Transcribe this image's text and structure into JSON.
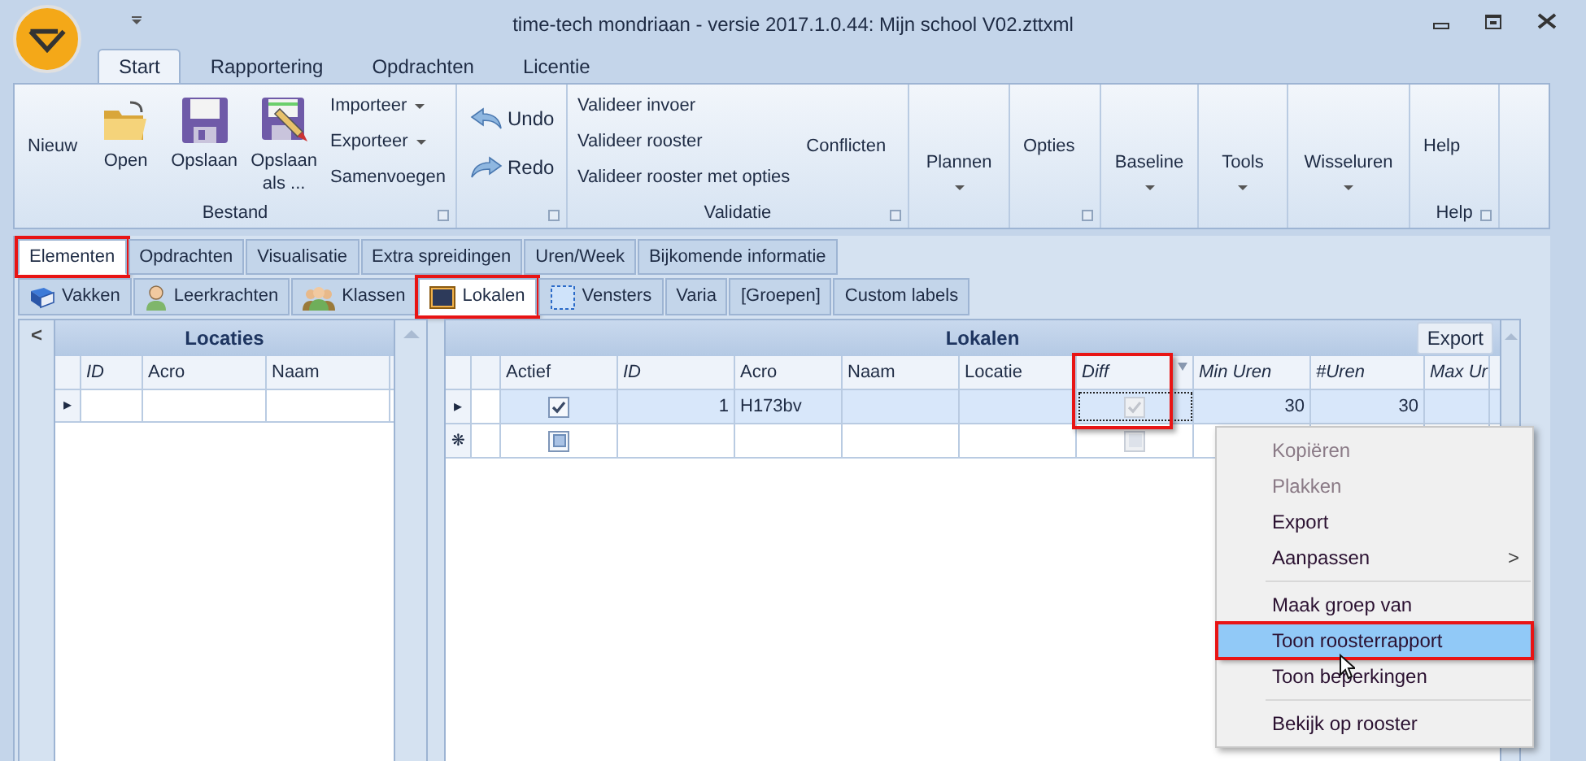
{
  "window": {
    "title": "time-tech mondriaan - versie 2017.1.0.44: Mijn school V02.zttxml"
  },
  "ribbon_tabs": [
    {
      "label": "Start",
      "selected": true
    },
    {
      "label": "Rapportering",
      "selected": false
    },
    {
      "label": "Opdrachten",
      "selected": false
    },
    {
      "label": "Licentie",
      "selected": false
    }
  ],
  "ribbon_groups": [
    {
      "label": "Bestand",
      "launcher": true,
      "items": [
        {
          "kind": "text",
          "label": "Nieuw"
        },
        {
          "kind": "large",
          "label": "Open"
        },
        {
          "kind": "large",
          "label": "Opslaan"
        },
        {
          "kind": "large",
          "label": "Opslaan als ..."
        },
        {
          "kind": "stack",
          "entries": [
            {
              "label": "Importeer",
              "dropdown": true
            },
            {
              "label": "Exporteer",
              "dropdown": true
            },
            {
              "label": "Samenvoegen",
              "dropdown": false
            }
          ]
        }
      ]
    },
    {
      "launcher": true,
      "items": [
        {
          "kind": "arrows",
          "entries": [
            {
              "label": "Undo"
            },
            {
              "label": "Redo"
            }
          ]
        }
      ]
    },
    {
      "label": "Validatie",
      "launcher": true,
      "items": [
        {
          "kind": "stack",
          "entries": [
            {
              "label": "Valideer invoer",
              "dropdown": false
            },
            {
              "label": "Valideer rooster",
              "dropdown": false
            },
            {
              "label": "Valideer rooster met opties",
              "dropdown": false
            }
          ]
        },
        {
          "kind": "text",
          "label": "Conflicten"
        }
      ]
    },
    {
      "launcher": false,
      "items": [
        {
          "kind": "menu",
          "label": "Plannen"
        }
      ]
    },
    {
      "launcher": true,
      "items": [
        {
          "kind": "text",
          "label": "Opties"
        }
      ]
    },
    {
      "launcher": false,
      "items": [
        {
          "kind": "menu",
          "label": "Baseline"
        }
      ]
    },
    {
      "launcher": false,
      "items": [
        {
          "kind": "menu",
          "label": "Tools"
        }
      ]
    },
    {
      "launcher": false,
      "items": [
        {
          "kind": "menu",
          "label": "Wisseluren"
        }
      ]
    },
    {
      "label": "Help",
      "launcher": true,
      "items": [
        {
          "kind": "text",
          "label": "Help"
        }
      ]
    }
  ],
  "main_tabs": [
    {
      "label": "Elementen",
      "selected": true,
      "highlighted": true
    },
    {
      "label": "Opdrachten",
      "selected": false,
      "highlighted": false
    },
    {
      "label": "Visualisatie",
      "selected": false,
      "highlighted": false
    },
    {
      "label": "Extra spreidingen",
      "selected": false,
      "highlighted": false
    },
    {
      "label": "Uren/Week",
      "selected": false,
      "highlighted": false
    },
    {
      "label": "Bijkomende informatie",
      "selected": false,
      "highlighted": false
    }
  ],
  "sub_tabs": [
    {
      "label": "Vakken",
      "selected": false,
      "highlighted": false
    },
    {
      "label": "Leerkrachten",
      "selected": false,
      "highlighted": false
    },
    {
      "label": "Klassen",
      "selected": false,
      "highlighted": false
    },
    {
      "label": "Lokalen",
      "selected": true,
      "highlighted": true
    },
    {
      "label": "Vensters",
      "selected": false,
      "highlighted": false
    },
    {
      "label": "Varia",
      "selected": false,
      "highlighted": false
    },
    {
      "label": "[Groepen]",
      "selected": false,
      "highlighted": false
    },
    {
      "label": "Custom labels",
      "selected": false,
      "highlighted": false
    }
  ],
  "locaties": {
    "collapse": "<",
    "title": "Locaties",
    "columns": [
      {
        "label": "ID",
        "italic": true
      },
      {
        "label": "Acro",
        "italic": false
      },
      {
        "label": "Naam",
        "italic": false
      }
    ],
    "rows": [
      {
        "indicator": "▸"
      }
    ]
  },
  "lokalen": {
    "title": "Lokalen",
    "export_button": "Export",
    "columns": [
      {
        "label": "Actief",
        "italic": false,
        "highlighted": false
      },
      {
        "label": "ID",
        "italic": true,
        "highlighted": false
      },
      {
        "label": "Acro",
        "italic": false,
        "highlighted": false
      },
      {
        "label": "Naam",
        "italic": false,
        "highlighted": false
      },
      {
        "label": "Locatie",
        "italic": false,
        "highlighted": false
      },
      {
        "label": "Diff",
        "italic": true,
        "highlighted": true
      },
      {
        "label": "Min Uren",
        "italic": true,
        "highlighted": false
      },
      {
        "label": "#Uren",
        "italic": true,
        "highlighted": false
      },
      {
        "label": "Max Ur",
        "italic": true,
        "highlighted": false
      }
    ],
    "rows": [
      {
        "indicator": "▸",
        "selected": true,
        "actief": true,
        "id": "1",
        "acro": "H173bv",
        "diff": true,
        "min_uren": "30",
        "uren": "30"
      },
      {
        "indicator": "❋",
        "selected": false,
        "actief": false,
        "diff": false
      }
    ]
  },
  "context_menu": [
    {
      "kind": "item",
      "label": "Kopiëren",
      "disabled": true,
      "selected": false
    },
    {
      "kind": "item",
      "label": "Plakken",
      "disabled": true,
      "selected": false
    },
    {
      "kind": "item",
      "label": "Export",
      "disabled": false,
      "selected": false
    },
    {
      "kind": "submenu",
      "label": "Aanpassen",
      "arrow": ">",
      "disabled": false,
      "selected": false
    },
    {
      "kind": "separator"
    },
    {
      "kind": "item",
      "label": "Maak groep van",
      "disabled": false,
      "selected": false
    },
    {
      "kind": "item",
      "label": "Toon roosterrapport",
      "disabled": false,
      "selected": true,
      "highlighted": true
    },
    {
      "kind": "item",
      "label": "Toon beperkingen",
      "disabled": false,
      "selected": false
    },
    {
      "kind": "separator"
    },
    {
      "kind": "item",
      "label": "Bekijk op rooster",
      "disabled": false,
      "selected": false
    }
  ]
}
